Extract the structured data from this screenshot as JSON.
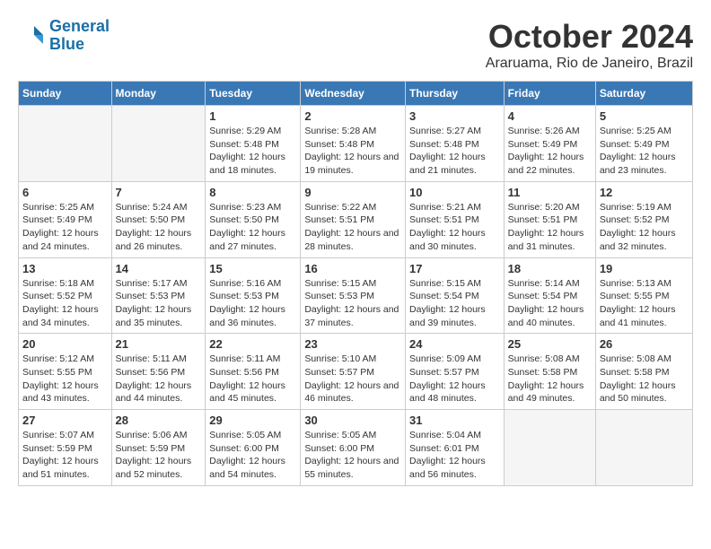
{
  "header": {
    "logo_line1": "General",
    "logo_line2": "Blue",
    "month": "October 2024",
    "location": "Araruama, Rio de Janeiro, Brazil"
  },
  "weekdays": [
    "Sunday",
    "Monday",
    "Tuesday",
    "Wednesday",
    "Thursday",
    "Friday",
    "Saturday"
  ],
  "weeks": [
    [
      {
        "day": "",
        "sunrise": "",
        "sunset": "",
        "daylight": "",
        "empty": true
      },
      {
        "day": "",
        "sunrise": "",
        "sunset": "",
        "daylight": "",
        "empty": true
      },
      {
        "day": "1",
        "sunrise": "Sunrise: 5:29 AM",
        "sunset": "Sunset: 5:48 PM",
        "daylight": "Daylight: 12 hours and 18 minutes."
      },
      {
        "day": "2",
        "sunrise": "Sunrise: 5:28 AM",
        "sunset": "Sunset: 5:48 PM",
        "daylight": "Daylight: 12 hours and 19 minutes."
      },
      {
        "day": "3",
        "sunrise": "Sunrise: 5:27 AM",
        "sunset": "Sunset: 5:48 PM",
        "daylight": "Daylight: 12 hours and 21 minutes."
      },
      {
        "day": "4",
        "sunrise": "Sunrise: 5:26 AM",
        "sunset": "Sunset: 5:49 PM",
        "daylight": "Daylight: 12 hours and 22 minutes."
      },
      {
        "day": "5",
        "sunrise": "Sunrise: 5:25 AM",
        "sunset": "Sunset: 5:49 PM",
        "daylight": "Daylight: 12 hours and 23 minutes."
      }
    ],
    [
      {
        "day": "6",
        "sunrise": "Sunrise: 5:25 AM",
        "sunset": "Sunset: 5:49 PM",
        "daylight": "Daylight: 12 hours and 24 minutes."
      },
      {
        "day": "7",
        "sunrise": "Sunrise: 5:24 AM",
        "sunset": "Sunset: 5:50 PM",
        "daylight": "Daylight: 12 hours and 26 minutes."
      },
      {
        "day": "8",
        "sunrise": "Sunrise: 5:23 AM",
        "sunset": "Sunset: 5:50 PM",
        "daylight": "Daylight: 12 hours and 27 minutes."
      },
      {
        "day": "9",
        "sunrise": "Sunrise: 5:22 AM",
        "sunset": "Sunset: 5:51 PM",
        "daylight": "Daylight: 12 hours and 28 minutes."
      },
      {
        "day": "10",
        "sunrise": "Sunrise: 5:21 AM",
        "sunset": "Sunset: 5:51 PM",
        "daylight": "Daylight: 12 hours and 30 minutes."
      },
      {
        "day": "11",
        "sunrise": "Sunrise: 5:20 AM",
        "sunset": "Sunset: 5:51 PM",
        "daylight": "Daylight: 12 hours and 31 minutes."
      },
      {
        "day": "12",
        "sunrise": "Sunrise: 5:19 AM",
        "sunset": "Sunset: 5:52 PM",
        "daylight": "Daylight: 12 hours and 32 minutes."
      }
    ],
    [
      {
        "day": "13",
        "sunrise": "Sunrise: 5:18 AM",
        "sunset": "Sunset: 5:52 PM",
        "daylight": "Daylight: 12 hours and 34 minutes."
      },
      {
        "day": "14",
        "sunrise": "Sunrise: 5:17 AM",
        "sunset": "Sunset: 5:53 PM",
        "daylight": "Daylight: 12 hours and 35 minutes."
      },
      {
        "day": "15",
        "sunrise": "Sunrise: 5:16 AM",
        "sunset": "Sunset: 5:53 PM",
        "daylight": "Daylight: 12 hours and 36 minutes."
      },
      {
        "day": "16",
        "sunrise": "Sunrise: 5:15 AM",
        "sunset": "Sunset: 5:53 PM",
        "daylight": "Daylight: 12 hours and 37 minutes."
      },
      {
        "day": "17",
        "sunrise": "Sunrise: 5:15 AM",
        "sunset": "Sunset: 5:54 PM",
        "daylight": "Daylight: 12 hours and 39 minutes."
      },
      {
        "day": "18",
        "sunrise": "Sunrise: 5:14 AM",
        "sunset": "Sunset: 5:54 PM",
        "daylight": "Daylight: 12 hours and 40 minutes."
      },
      {
        "day": "19",
        "sunrise": "Sunrise: 5:13 AM",
        "sunset": "Sunset: 5:55 PM",
        "daylight": "Daylight: 12 hours and 41 minutes."
      }
    ],
    [
      {
        "day": "20",
        "sunrise": "Sunrise: 5:12 AM",
        "sunset": "Sunset: 5:55 PM",
        "daylight": "Daylight: 12 hours and 43 minutes."
      },
      {
        "day": "21",
        "sunrise": "Sunrise: 5:11 AM",
        "sunset": "Sunset: 5:56 PM",
        "daylight": "Daylight: 12 hours and 44 minutes."
      },
      {
        "day": "22",
        "sunrise": "Sunrise: 5:11 AM",
        "sunset": "Sunset: 5:56 PM",
        "daylight": "Daylight: 12 hours and 45 minutes."
      },
      {
        "day": "23",
        "sunrise": "Sunrise: 5:10 AM",
        "sunset": "Sunset: 5:57 PM",
        "daylight": "Daylight: 12 hours and 46 minutes."
      },
      {
        "day": "24",
        "sunrise": "Sunrise: 5:09 AM",
        "sunset": "Sunset: 5:57 PM",
        "daylight": "Daylight: 12 hours and 48 minutes."
      },
      {
        "day": "25",
        "sunrise": "Sunrise: 5:08 AM",
        "sunset": "Sunset: 5:58 PM",
        "daylight": "Daylight: 12 hours and 49 minutes."
      },
      {
        "day": "26",
        "sunrise": "Sunrise: 5:08 AM",
        "sunset": "Sunset: 5:58 PM",
        "daylight": "Daylight: 12 hours and 50 minutes."
      }
    ],
    [
      {
        "day": "27",
        "sunrise": "Sunrise: 5:07 AM",
        "sunset": "Sunset: 5:59 PM",
        "daylight": "Daylight: 12 hours and 51 minutes."
      },
      {
        "day": "28",
        "sunrise": "Sunrise: 5:06 AM",
        "sunset": "Sunset: 5:59 PM",
        "daylight": "Daylight: 12 hours and 52 minutes."
      },
      {
        "day": "29",
        "sunrise": "Sunrise: 5:05 AM",
        "sunset": "Sunset: 6:00 PM",
        "daylight": "Daylight: 12 hours and 54 minutes."
      },
      {
        "day": "30",
        "sunrise": "Sunrise: 5:05 AM",
        "sunset": "Sunset: 6:00 PM",
        "daylight": "Daylight: 12 hours and 55 minutes."
      },
      {
        "day": "31",
        "sunrise": "Sunrise: 5:04 AM",
        "sunset": "Sunset: 6:01 PM",
        "daylight": "Daylight: 12 hours and 56 minutes."
      },
      {
        "day": "",
        "sunrise": "",
        "sunset": "",
        "daylight": "",
        "empty": true
      },
      {
        "day": "",
        "sunrise": "",
        "sunset": "",
        "daylight": "",
        "empty": true
      }
    ]
  ]
}
